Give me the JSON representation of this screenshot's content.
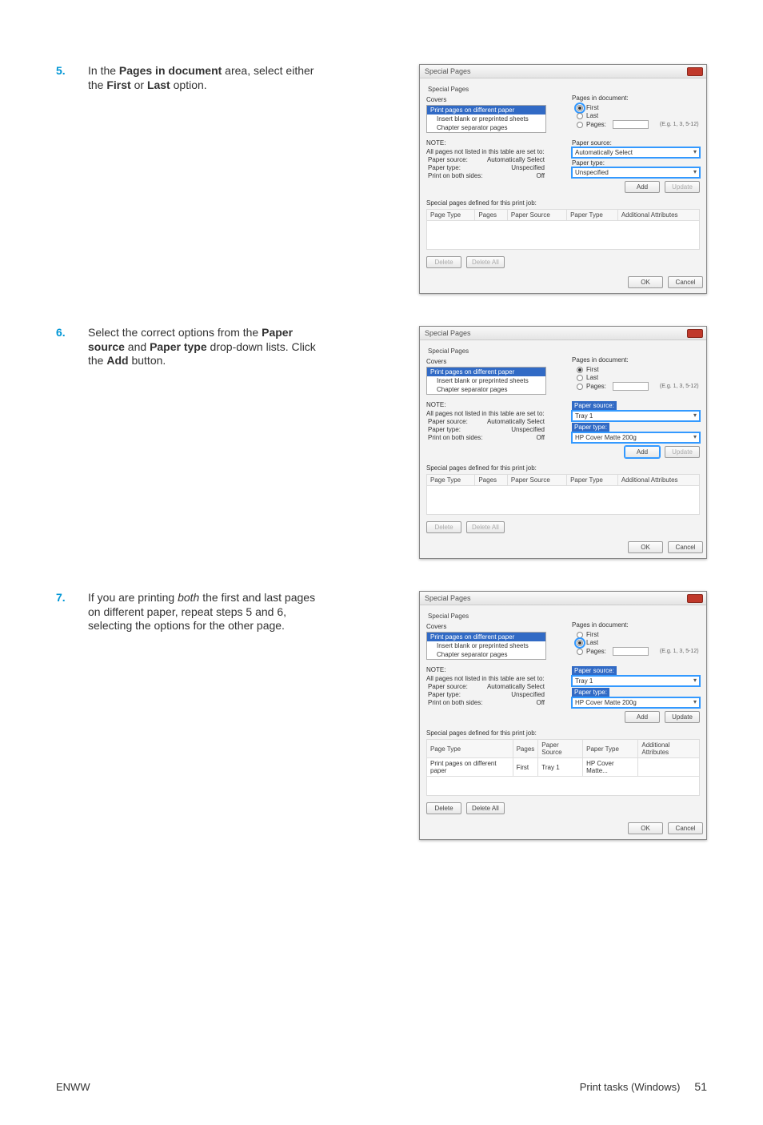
{
  "steps": [
    {
      "num": "5.",
      "lead": "In the ",
      "bold1": "Pages in document",
      "mid1": " area, select either the ",
      "bold2": "First",
      "mid2": " or ",
      "bold3": "Last",
      "tail": " option."
    },
    {
      "num": "6.",
      "lead": "Select the correct options from the ",
      "bold1": "Paper source",
      "mid1": " and ",
      "bold2": "Paper type",
      "mid2": " drop-down lists. Click the ",
      "bold3": "Add",
      "tail": " button."
    },
    {
      "num": "7.",
      "lead": "If you are printing ",
      "ital": "both",
      "mid1": " the first and last pages on different paper, repeat steps 5 and 6, selecting the options for the other page.",
      "bold1": "",
      "bold2": "",
      "bold3": "",
      "mid2": "",
      "tail": ""
    }
  ],
  "dlg": {
    "title": "Special Pages",
    "group": "Special Pages",
    "covers_label": "Covers",
    "covers_items": {
      "a": "Print pages on different paper",
      "b": "Insert blank or preprinted sheets",
      "c": "Chapter separator pages"
    },
    "pagesdoc": "Pages in document:",
    "first": "First",
    "last": "Last",
    "pages": "Pages:",
    "eg": "(E.g. 1, 3, 5-12)",
    "note": "NOTE:",
    "note_sub": "All pages not listed in this table are set to:",
    "ps": "Paper source:",
    "pt": "Paper type:",
    "pb": "Print on both sides:",
    "ps_val": "Automatically Select",
    "pt_val": "Unspecified",
    "pb_val": "Off",
    "right_ps": "Paper source:",
    "right_pt": "Paper type:",
    "add": "Add",
    "update": "Update",
    "table_caption": "Special pages defined for this print job:",
    "cols": {
      "a": "Page Type",
      "b": "Pages",
      "c": "Paper Source",
      "d": "Paper Type",
      "e": "Additional Attributes"
    },
    "delete": "Delete",
    "delete_all": "Delete All",
    "ok": "OK",
    "cancel": "Cancel"
  },
  "dlg1": {
    "ps_sel": "Automatically Select",
    "pt_sel": "Unspecified"
  },
  "dlg2": {
    "ps_sel": "Tray 1",
    "pt_sel": "HP Cover Matte 200g"
  },
  "dlg3": {
    "ps_sel": "Tray 1",
    "pt_sel": "HP Cover Matte 200g",
    "row": {
      "a": "Print pages on different paper",
      "b": "First",
      "c": "Tray 1",
      "d": "HP Cover Matte...",
      "e": ""
    }
  },
  "footer": {
    "left": "ENWW",
    "right": "Print tasks (Windows)",
    "page": "51"
  }
}
